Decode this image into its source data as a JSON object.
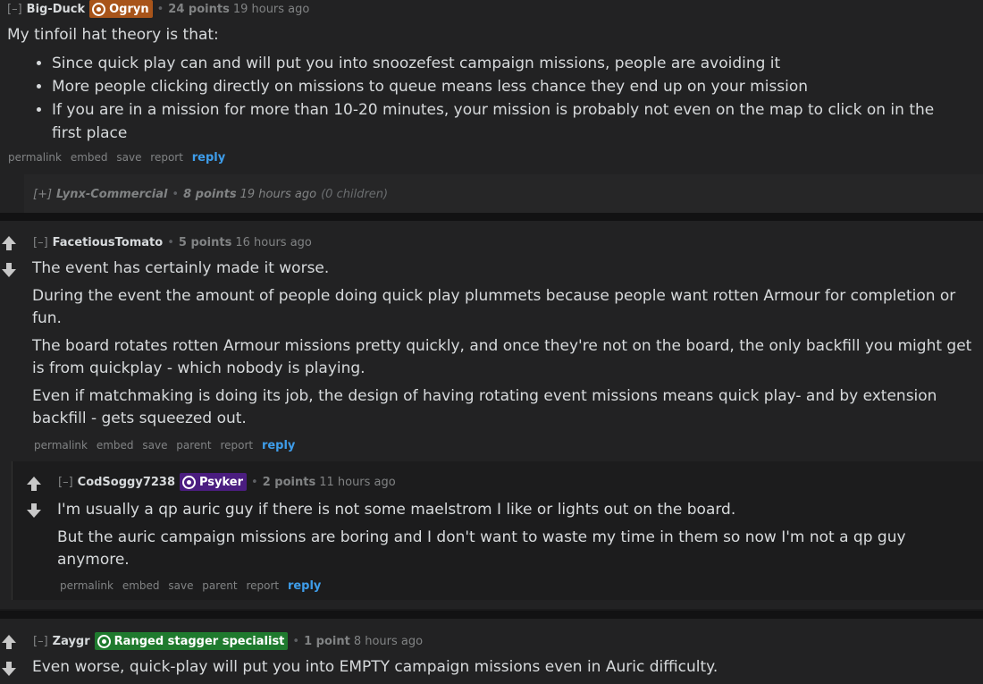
{
  "comments": [
    {
      "expand": "[–]",
      "author": "Big-Duck",
      "flair": "Ogryn",
      "flair_color": "#a8541a",
      "score": "24 points",
      "time": "19 hours ago",
      "intro": "My tinfoil hat theory is that:",
      "bullets": [
        "Since quick play can and will put you into snoozefest campaign missions, people are avoiding it",
        "More people clicking directly on missions to queue means less chance they end up on your mission",
        "If you are in a mission for more than 10-20 minutes, your mission is probably not even on the map to click on in the first place"
      ],
      "buttons": [
        "permalink",
        "embed",
        "save",
        "report"
      ],
      "reply": "reply"
    },
    {
      "expand": "[+]",
      "author": "Lynx-Commercial",
      "score": "8 points",
      "time": "19 hours ago",
      "children": "(0 children)"
    },
    {
      "expand": "[–]",
      "author": "FacetiousTomato",
      "score": "5 points",
      "time": "16 hours ago",
      "paragraphs": [
        "The event has certainly made it worse.",
        "During the event the amount of people doing quick play plummets because people want rotten Armour for completion or fun.",
        "The board rotates rotten Armour missions pretty quickly, and once they're not on the board, the only backfill you might get is from quickplay - which nobody is playing.",
        "Even if matchmaking is doing its job, the design of having rotating event missions means quick play- and by extension backfill - gets squeezed out."
      ],
      "buttons": [
        "permalink",
        "embed",
        "save",
        "parent",
        "report"
      ],
      "reply": "reply"
    },
    {
      "expand": "[–]",
      "author": "CodSoggy7238",
      "flair": "Psyker",
      "flair_color": "#4b1d80",
      "score": "2 points",
      "time": "11 hours ago",
      "paragraphs": [
        "I'm usually a qp auric guy if there is not some maelstrom I like or lights out on the board.",
        "But the auric campaign missions are boring and I don't want to waste my time in them so now I'm not a qp guy anymore."
      ],
      "buttons": [
        "permalink",
        "embed",
        "save",
        "parent",
        "report"
      ],
      "reply": "reply"
    },
    {
      "expand": "[–]",
      "author": "Zaygr",
      "flair": "Ranged stagger specialist",
      "flair_color": "#1f7a2e",
      "score": "1 point",
      "time": "8 hours ago",
      "paragraphs": [
        "Even worse, quick-play will put you into EMPTY campaign missions even in Auric difficulty."
      ]
    }
  ],
  "dot": "•"
}
